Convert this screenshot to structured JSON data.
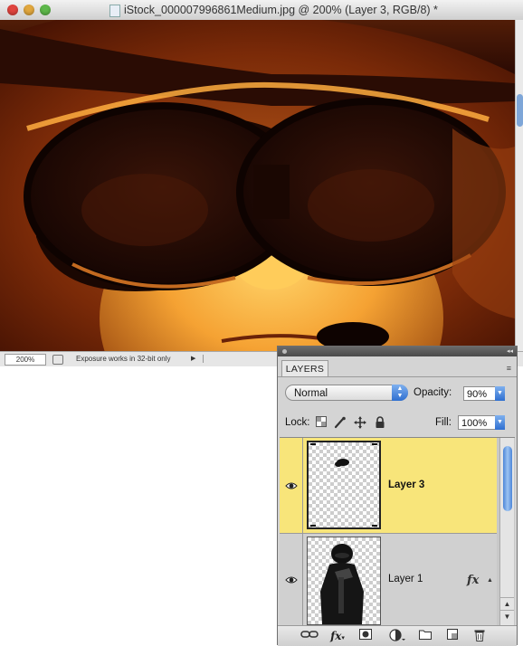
{
  "document": {
    "title": "iStock_000007996861Medium.jpg @ 200% (Layer 3, RGB/8) *",
    "zoom": "200%",
    "status_text": "Exposure works in 32-bit only",
    "status_arrow": "▶"
  },
  "layers_panel": {
    "tab_label": "LAYERS",
    "menu_icon": "≡",
    "collapse_icon": "◂◂",
    "blend_mode": "Normal",
    "opacity_label": "Opacity:",
    "opacity_value": "90%",
    "lock_label": "Lock:",
    "fill_label": "Fill:",
    "fill_value": "100%",
    "layers": [
      {
        "name": "Layer 3",
        "visible": true,
        "selected": true
      },
      {
        "name": "Layer 1",
        "visible": true,
        "selected": false,
        "has_effects": true,
        "fx_label": "fx"
      }
    ],
    "footer_icons": [
      "link-layers-icon",
      "layer-style-icon",
      "layer-mask-icon",
      "adjustment-layer-icon",
      "new-group-icon",
      "new-layer-icon",
      "trash-icon"
    ]
  },
  "colors": {
    "selected_layer": "#f8e57a",
    "accent_blue": "#2f6fd0",
    "image_glow": "#ffb43a",
    "image_dark": "#1a0702"
  }
}
